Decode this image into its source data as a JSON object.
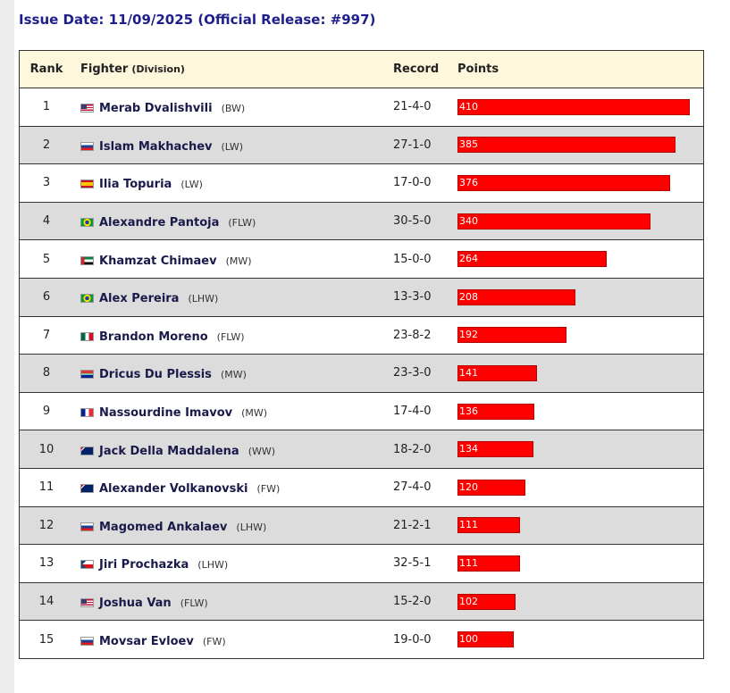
{
  "header": {
    "issue": "Issue Date: 11/09/2025 (Official Release: #997)"
  },
  "table": {
    "col_rank": "Rank",
    "col_fighter": "Fighter",
    "col_division": "(Division)",
    "col_record": "Record",
    "col_points": "Points"
  },
  "colors": {
    "bar": "#ff0000",
    "header_bg": "#fdf7dc",
    "stripe": "#dcdcdc",
    "title": "#1f1f8c"
  },
  "chart_data": {
    "type": "bar",
    "orientation": "horizontal",
    "xlim": [
      0,
      410
    ],
    "categories": [
      "Merab Dvalishvili",
      "Islam Makhachev",
      "Ilia Topuria",
      "Alexandre Pantoja",
      "Khamzat Chimaev",
      "Alex Pereira",
      "Brandon Moreno",
      "Dricus Du Plessis",
      "Nassourdine Imavov",
      "Jack Della Maddalena",
      "Alexander Volkanovski",
      "Magomed Ankalaev",
      "Jiri Prochazka",
      "Joshua Van",
      "Movsar Evloev"
    ],
    "values": [
      410,
      385,
      376,
      340,
      264,
      208,
      192,
      141,
      136,
      134,
      120,
      111,
      111,
      102,
      100
    ],
    "rows": [
      {
        "rank": "1",
        "name": "Merab Dvalishvili",
        "division": "(BW)",
        "record": "21-4-0",
        "points": "410",
        "flag": "us-flag-icon"
      },
      {
        "rank": "2",
        "name": "Islam Makhachev",
        "division": "(LW)",
        "record": "27-1-0",
        "points": "385",
        "flag": "russia-flag-icon"
      },
      {
        "rank": "3",
        "name": "Ilia Topuria",
        "division": "(LW)",
        "record": "17-0-0",
        "points": "376",
        "flag": "spain-flag-icon"
      },
      {
        "rank": "4",
        "name": "Alexandre Pantoja",
        "division": "(FLW)",
        "record": "30-5-0",
        "points": "340",
        "flag": "brazil-flag-icon"
      },
      {
        "rank": "5",
        "name": "Khamzat Chimaev",
        "division": "(MW)",
        "record": "15-0-0",
        "points": "264",
        "flag": "uae-flag-icon"
      },
      {
        "rank": "6",
        "name": "Alex Pereira",
        "division": "(LHW)",
        "record": "13-3-0",
        "points": "208",
        "flag": "brazil-flag-icon"
      },
      {
        "rank": "7",
        "name": "Brandon Moreno",
        "division": "(FLW)",
        "record": "23-8-2",
        "points": "192",
        "flag": "mexico-flag-icon"
      },
      {
        "rank": "8",
        "name": "Dricus Du Plessis",
        "division": "(MW)",
        "record": "23-3-0",
        "points": "141",
        "flag": "south-africa-flag-icon"
      },
      {
        "rank": "9",
        "name": "Nassourdine Imavov",
        "division": "(MW)",
        "record": "17-4-0",
        "points": "136",
        "flag": "france-flag-icon"
      },
      {
        "rank": "10",
        "name": "Jack Della Maddalena",
        "division": "(WW)",
        "record": "18-2-0",
        "points": "134",
        "flag": "australia-flag-icon"
      },
      {
        "rank": "11",
        "name": "Alexander Volkanovski",
        "division": "(FW)",
        "record": "27-4-0",
        "points": "120",
        "flag": "australia-flag-icon"
      },
      {
        "rank": "12",
        "name": "Magomed Ankalaev",
        "division": "(LHW)",
        "record": "21-2-1",
        "points": "111",
        "flag": "russia-flag-icon"
      },
      {
        "rank": "13",
        "name": "Jiri Prochazka",
        "division": "(LHW)",
        "record": "32-5-1",
        "points": "111",
        "flag": "czech-flag-icon"
      },
      {
        "rank": "14",
        "name": "Joshua Van",
        "division": "(FLW)",
        "record": "15-2-0",
        "points": "102",
        "flag": "us-flag-icon"
      },
      {
        "rank": "15",
        "name": "Movsar Evloev",
        "division": "(FW)",
        "record": "19-0-0",
        "points": "100",
        "flag": "russia-flag-icon"
      }
    ]
  }
}
